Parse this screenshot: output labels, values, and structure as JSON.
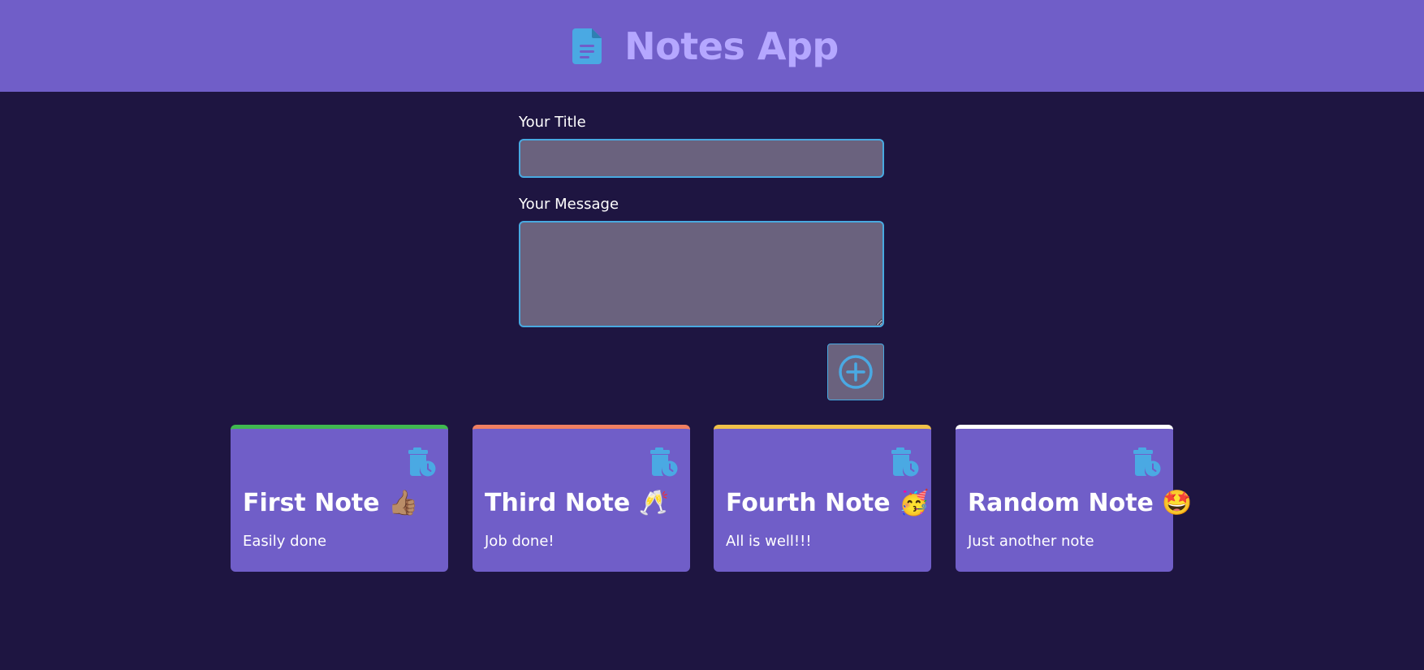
{
  "header": {
    "title": "Notes App",
    "icon": "document-icon"
  },
  "form": {
    "title_label": "Your Title",
    "title_value": "",
    "message_label": "Your Message",
    "message_value": "",
    "add_button_icon": "plus-circle-icon"
  },
  "notes": [
    {
      "title": "First Note 👍🏽",
      "body": "Easily done",
      "accent": "#3fb950",
      "delete_icon": "delete-timer-icon"
    },
    {
      "title": "Third Note 🥂",
      "body": "Job done!",
      "accent": "#f07f62",
      "delete_icon": "delete-timer-icon"
    },
    {
      "title": "Fourth Note 🥳",
      "body": "All is well!!!",
      "accent": "#f0c14a",
      "delete_icon": "delete-timer-icon"
    },
    {
      "title": "Random Note 🤩",
      "body": "Just another note",
      "accent": "#ffffff",
      "delete_icon": "delete-timer-icon"
    }
  ],
  "colors": {
    "background": "#1e1541",
    "header": "#705ec8",
    "title_text": "#b5a7ff",
    "input_bg": "#6a627e",
    "input_border": "#48a9e0",
    "icon_blue": "#4aa9e3",
    "card": "#705ec8"
  }
}
